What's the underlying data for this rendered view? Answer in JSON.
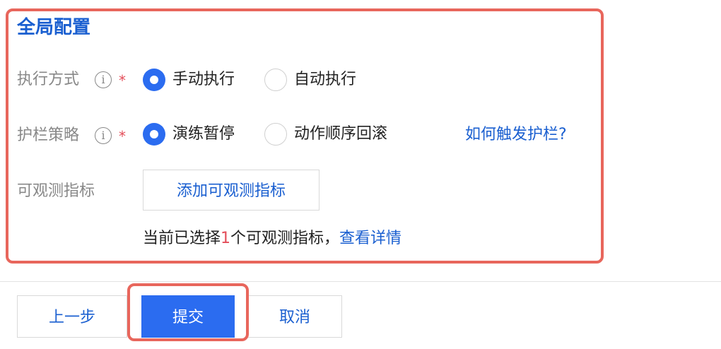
{
  "panel": {
    "title": "全局配置"
  },
  "execution_mode": {
    "label": "执行方式",
    "info_icon": "info-icon",
    "required_mark": "*",
    "options": [
      {
        "label": "手动执行",
        "selected": true
      },
      {
        "label": "自动执行",
        "selected": false
      }
    ]
  },
  "guardrail_strategy": {
    "label": "护栏策略",
    "info_icon": "info-icon",
    "required_mark": "*",
    "options": [
      {
        "label": "演练暂停",
        "selected": true
      },
      {
        "label": "动作顺序回滚",
        "selected": false
      }
    ],
    "help_link": "如何触发护栏?"
  },
  "observability_metrics": {
    "label": "可观测指标",
    "add_button": "添加可观测指标",
    "selected_prefix": "当前已选择",
    "selected_count": "1",
    "selected_suffix": "个可观测指标，",
    "view_details_link": "查看详情"
  },
  "footer": {
    "prev_button": "上一步",
    "submit_button": "提交",
    "cancel_button": "取消"
  },
  "colors": {
    "accent": "#2b6cf0",
    "link": "#1a5fd0",
    "highlight_border": "#e8665c",
    "required": "#e34d59"
  }
}
